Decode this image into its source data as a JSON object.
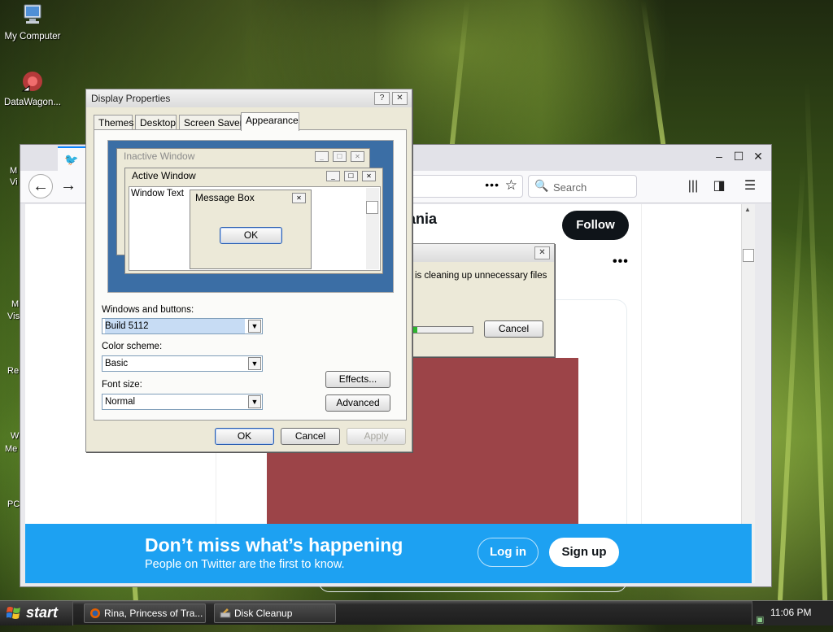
{
  "desktop": {
    "icons": [
      {
        "label": "My Computer",
        "icon": "my-computer-icon"
      },
      {
        "label": "DataWagon...",
        "icon": "datawagon-icon"
      }
    ],
    "edge_labels": [
      "M",
      "Vi",
      "M",
      "Vis",
      "Re",
      "W",
      "Me",
      "PC"
    ]
  },
  "firefox": {
    "search_placeholder": "Search",
    "url_dots": "•••",
    "profile_name_partial": "ania",
    "follow_label": "Follow",
    "more_label": "•••",
    "banner": {
      "title": "Don’t miss what’s happening",
      "subtitle": "People on Twitter are the first to know.",
      "login_label": "Log in",
      "signup_label": "Sign up"
    },
    "colors": {
      "twitter_blue": "#1da1f2",
      "media": "#9c4448",
      "follow_bg": "#0f1419"
    }
  },
  "disk_cleanup": {
    "message": "is cleaning up unnecessary files",
    "cancel_label": "Cancel",
    "progress": 0.07
  },
  "display_properties": {
    "title": "Display Properties",
    "help_label": "?",
    "close_label": "✕",
    "tabs": [
      {
        "label": "Themes",
        "active": false
      },
      {
        "label": "Desktop",
        "active": false
      },
      {
        "label": "Screen Saver",
        "active": false
      },
      {
        "label": "Appearance",
        "active": true
      }
    ],
    "preview": {
      "inactive_title": "Inactive Window",
      "active_title": "Active Window",
      "window_text": "Window Text",
      "message_box_title": "Message Box",
      "message_box_ok": "OK"
    },
    "windows_buttons_label": "Windows and buttons:",
    "windows_buttons_value": "Build 5112",
    "color_scheme_label": "Color scheme:",
    "color_scheme_value": "Basic",
    "font_size_label": "Font size:",
    "font_size_value": "Normal",
    "effects_label": "Effects...",
    "advanced_label": "Advanced",
    "ok_label": "OK",
    "cancel_label": "Cancel",
    "apply_label": "Apply"
  },
  "taskbar": {
    "start_label": "start",
    "tasks": [
      {
        "label": "Rina, Princess of Tra...",
        "icon": "firefox-icon"
      },
      {
        "label": "Disk Cleanup",
        "icon": "disk-cleanup-icon"
      }
    ],
    "clock": "11:06 PM"
  }
}
